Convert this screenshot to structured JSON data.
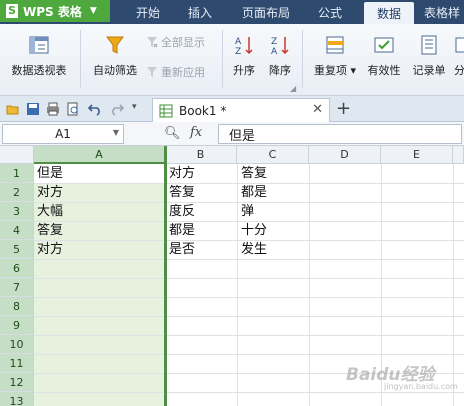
{
  "app": {
    "name": "WPS 表格"
  },
  "menu": {
    "tabs": [
      {
        "label": "开始",
        "active": false
      },
      {
        "label": "插入",
        "active": false
      },
      {
        "label": "页面布局",
        "active": false
      },
      {
        "label": "公式",
        "active": false
      },
      {
        "label": "数据",
        "active": true
      },
      {
        "label": "表格样"
      }
    ]
  },
  "ribbon": {
    "pivot": "数据透视表",
    "autofilter": "自动筛选",
    "show_all": "全部显示",
    "reapply": "重新应用",
    "sort_asc": "升序",
    "sort_desc": "降序",
    "duplicates": "重复项",
    "validity": "有效性",
    "record": "记录单",
    "more": "分"
  },
  "doc_tab": {
    "title": "Book1 *"
  },
  "formula_bar": {
    "name_box": "A1",
    "fx": "fx",
    "content": "但是"
  },
  "sheet": {
    "columns": [
      "A",
      "B",
      "C",
      "D",
      "E"
    ],
    "selected_column": "A",
    "rows": [
      "1",
      "2",
      "3",
      "4",
      "5",
      "6",
      "7",
      "8",
      "9",
      "10",
      "11",
      "12",
      "13"
    ],
    "cells": {
      "A": [
        "但是",
        "对方",
        "大幅",
        "答复",
        "对方"
      ],
      "B": [
        "对方",
        "答复",
        "度反",
        "都是",
        "是否"
      ],
      "C": [
        "答复",
        "都是",
        "弹",
        "十分",
        "发生"
      ]
    }
  },
  "colors": {
    "app_green": "#4fa83d",
    "selection_green": "#4f8f44",
    "title_bar": "#2e4a6e"
  },
  "watermark": {
    "text": "Baidu经验",
    "sub": "jingyan.baidu.com"
  }
}
